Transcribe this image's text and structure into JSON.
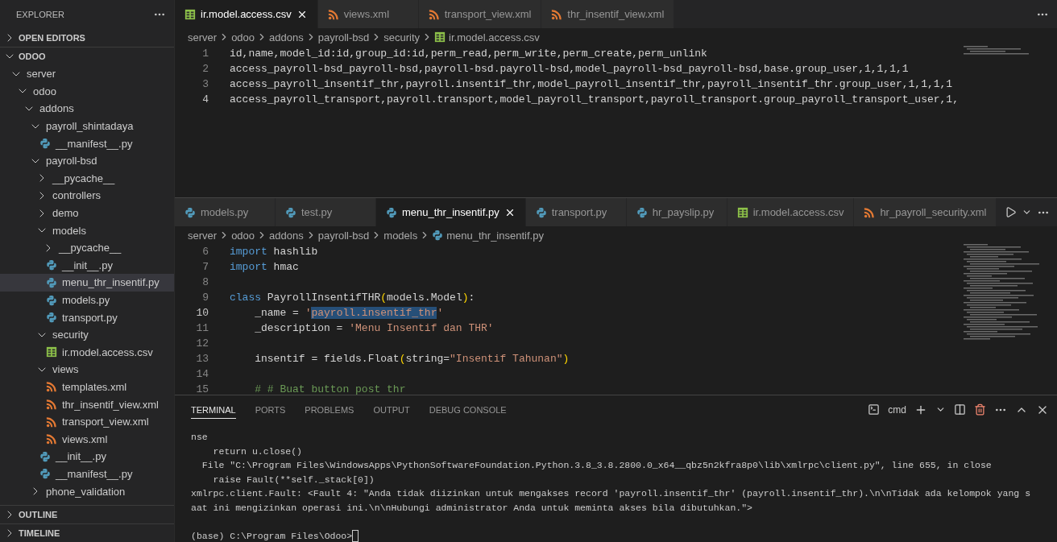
{
  "sidebar": {
    "title": "EXPLORER",
    "sections": [
      {
        "label": "OPEN EDITORS",
        "expanded": false
      },
      {
        "label": "ODOO",
        "expanded": true,
        "children": [
          {
            "label": "server",
            "kind": "folder",
            "expanded": true,
            "selected": false,
            "children": [
              {
                "label": "odoo",
                "kind": "folder",
                "expanded": true,
                "selected": false,
                "children": [
                  {
                    "label": "addons",
                    "kind": "folder",
                    "expanded": true,
                    "selected": false,
                    "children": [
                      {
                        "label": "payroll_shintadaya",
                        "kind": "folder",
                        "expanded": true,
                        "selected": false,
                        "children": [
                          {
                            "label": "__manifest__.py",
                            "kind": "python",
                            "selected": false
                          }
                        ]
                      },
                      {
                        "label": "payroll-bsd",
                        "kind": "folder",
                        "expanded": true,
                        "selected": false,
                        "children": [
                          {
                            "label": "__pycache__",
                            "kind": "folder",
                            "expanded": false,
                            "selected": false
                          },
                          {
                            "label": "controllers",
                            "kind": "folder",
                            "expanded": false,
                            "selected": false
                          },
                          {
                            "label": "demo",
                            "kind": "folder",
                            "expanded": false,
                            "selected": false
                          },
                          {
                            "label": "models",
                            "kind": "folder",
                            "expanded": true,
                            "selected": false,
                            "children": [
                              {
                                "label": "__pycache__",
                                "kind": "folder",
                                "expanded": false,
                                "selected": false
                              },
                              {
                                "label": "__init__.py",
                                "kind": "python",
                                "selected": false
                              },
                              {
                                "label": "menu_thr_insentif.py",
                                "kind": "python",
                                "selected": true
                              },
                              {
                                "label": "models.py",
                                "kind": "python",
                                "selected": false
                              },
                              {
                                "label": "transport.py",
                                "kind": "python",
                                "selected": false
                              }
                            ]
                          },
                          {
                            "label": "security",
                            "kind": "folder",
                            "expanded": true,
                            "selected": false,
                            "children": [
                              {
                                "label": "ir.model.access.csv",
                                "kind": "csv",
                                "selected": false
                              }
                            ]
                          },
                          {
                            "label": "views",
                            "kind": "folder",
                            "expanded": true,
                            "selected": false,
                            "children": [
                              {
                                "label": "templates.xml",
                                "kind": "xml",
                                "selected": false
                              },
                              {
                                "label": "thr_insentif_view.xml",
                                "kind": "xml",
                                "selected": false
                              },
                              {
                                "label": "transport_view.xml",
                                "kind": "xml",
                                "selected": false
                              },
                              {
                                "label": "views.xml",
                                "kind": "xml",
                                "selected": false
                              }
                            ]
                          },
                          {
                            "label": "__init__.py",
                            "kind": "python",
                            "selected": false
                          },
                          {
                            "label": "__manifest__.py",
                            "kind": "python",
                            "selected": false
                          }
                        ]
                      },
                      {
                        "label": "phone_validation",
                        "kind": "folder",
                        "expanded": false,
                        "selected": false
                      }
                    ]
                  }
                ]
              }
            ]
          }
        ]
      },
      {
        "label": "OUTLINE",
        "expanded": false
      },
      {
        "label": "TIMELINE",
        "expanded": false
      }
    ]
  },
  "editor_groups": [
    {
      "tabs": [
        {
          "label": "ir.model.access.csv",
          "kind": "csv",
          "selected": true
        },
        {
          "label": "views.xml",
          "kind": "xml",
          "selected": false
        },
        {
          "label": "transport_view.xml",
          "kind": "xml",
          "selected": false
        },
        {
          "label": "thr_insentif_view.xml",
          "kind": "xml",
          "selected": false
        }
      ],
      "breadcrumb": [
        {
          "label": "server",
          "kind": "folder"
        },
        {
          "label": "odoo",
          "kind": "folder"
        },
        {
          "label": "addons",
          "kind": "folder"
        },
        {
          "label": "payroll-bsd",
          "kind": "folder"
        },
        {
          "label": "security",
          "kind": "folder"
        },
        {
          "label": "ir.model.access.csv",
          "kind": "csv"
        }
      ],
      "lines": [
        {
          "number": "1",
          "current": false,
          "tokens": [
            {
              "text": "id,name,model_id:id,group_id:id,perm_read,perm_write,perm_create,perm_unlink",
              "kind": "plain"
            }
          ]
        },
        {
          "number": "2",
          "current": false,
          "tokens": [
            {
              "text": "access_payroll-bsd_payroll-bsd,payroll-bsd.payroll-bsd,model_payroll-bsd_payroll-bsd,base.group_user,1,1,1,1",
              "kind": "plain"
            }
          ]
        },
        {
          "number": "3",
          "current": false,
          "tokens": [
            {
              "text": "access_payroll_insentif_thr,payroll.insentif_thr,model_payroll_insentif_thr,payroll_insentif_thr.group_user,1,1,1,1",
              "kind": "plain"
            }
          ]
        },
        {
          "number": "4",
          "current": true,
          "tokens": [
            {
              "text": "access_payroll_transport,payroll.transport,model_payroll_transport,payroll_transport.group_payroll_transport_user,1,",
              "kind": "plain"
            }
          ]
        }
      ]
    },
    {
      "run_button": true,
      "tabs": [
        {
          "label": "models.py",
          "kind": "python",
          "selected": false
        },
        {
          "label": "test.py",
          "kind": "python",
          "selected": false
        },
        {
          "label": "menu_thr_insentif.py",
          "kind": "python",
          "selected": true
        },
        {
          "label": "transport.py",
          "kind": "python",
          "selected": false
        },
        {
          "label": "hr_payslip.py",
          "kind": "python",
          "selected": false
        },
        {
          "label": "ir.model.access.csv",
          "kind": "csv",
          "selected": false
        },
        {
          "label": "hr_payroll_security.xml",
          "kind": "xml",
          "selected": false
        }
      ],
      "breadcrumb": [
        {
          "label": "server",
          "kind": "folder"
        },
        {
          "label": "odoo",
          "kind": "folder"
        },
        {
          "label": "addons",
          "kind": "folder"
        },
        {
          "label": "payroll-bsd",
          "kind": "folder"
        },
        {
          "label": "models",
          "kind": "folder"
        },
        {
          "label": "menu_thr_insentif.py",
          "kind": "python"
        }
      ],
      "lines": [
        {
          "number": "6",
          "current": false,
          "tokens": [
            {
              "text": "import",
              "kind": "keyword"
            },
            {
              "text": " hashlib",
              "kind": "plain"
            }
          ]
        },
        {
          "number": "7",
          "current": false,
          "tokens": [
            {
              "text": "import",
              "kind": "keyword"
            },
            {
              "text": " hmac",
              "kind": "plain"
            }
          ]
        },
        {
          "number": "8",
          "current": false
        },
        {
          "number": "9",
          "current": false,
          "tokens": [
            {
              "text": "class",
              "kind": "keyword"
            },
            {
              "text": " PayrollInsentifTHR",
              "kind": "plain"
            },
            {
              "text": "(",
              "kind": "bracket"
            },
            {
              "text": "models.Model",
              "kind": "plain"
            },
            {
              "text": ")",
              "kind": "bracket"
            },
            {
              "text": ":",
              "kind": "plain"
            }
          ]
        },
        {
          "number": "10",
          "current": true,
          "tokens": [
            {
              "text": "    _name = ",
              "kind": "plain"
            },
            {
              "text": "'",
              "kind": "string"
            },
            {
              "text": "payroll.insentif_thr",
              "kind": "string",
              "selected": true
            },
            {
              "text": "'",
              "kind": "string"
            }
          ]
        },
        {
          "number": "11",
          "current": false,
          "tokens": [
            {
              "text": "    _description = ",
              "kind": "plain"
            },
            {
              "text": "'Menu Insentif dan THR'",
              "kind": "string"
            }
          ]
        },
        {
          "number": "12",
          "current": false
        },
        {
          "number": "13",
          "current": false,
          "tokens": [
            {
              "text": "    insentif = fields.Float",
              "kind": "plain"
            },
            {
              "text": "(",
              "kind": "bracket"
            },
            {
              "text": "string=",
              "kind": "plain"
            },
            {
              "text": "\"Insentif Tahunan\"",
              "kind": "string"
            },
            {
              "text": ")",
              "kind": "bracket"
            }
          ]
        },
        {
          "number": "14",
          "current": false
        },
        {
          "number": "15",
          "current": false,
          "tokens": [
            {
              "text": "    # # Buat button post thr",
              "kind": "comment"
            }
          ]
        }
      ]
    }
  ],
  "panel": {
    "tabs": [
      {
        "label": "TERMINAL",
        "selected": true
      },
      {
        "label": "PORTS",
        "selected": false
      },
      {
        "label": "PROBLEMS",
        "selected": false
      },
      {
        "label": "OUTPUT",
        "selected": false
      },
      {
        "label": "DEBUG CONSOLE",
        "selected": false
      }
    ],
    "profile": "cmd",
    "lines": [
      "nse",
      "    return u.close()",
      "  File \"C:\\Program Files\\WindowsApps\\PythonSoftwareFoundation.Python.3.8_3.8.2800.0_x64__qbz5n2kfra8p0\\lib\\xmlrpc\\client.py\", line 655, in close",
      "    raise Fault(**self._stack[0])",
      "xmlrpc.client.Fault: <Fault 4: \"Anda tidak diizinkan untuk mengakses record 'payroll.insentif_thr' (payroll.insentif_thr).\\n\\nTidak ada kelompok yang s",
      "aat ini mengizinkan operasi ini.\\n\\nHubungi administrator Anda untuk meminta akses bila dibutuhkan.\">"
    ],
    "prompt": "(base) C:\\Program Files\\Odoo>"
  }
}
